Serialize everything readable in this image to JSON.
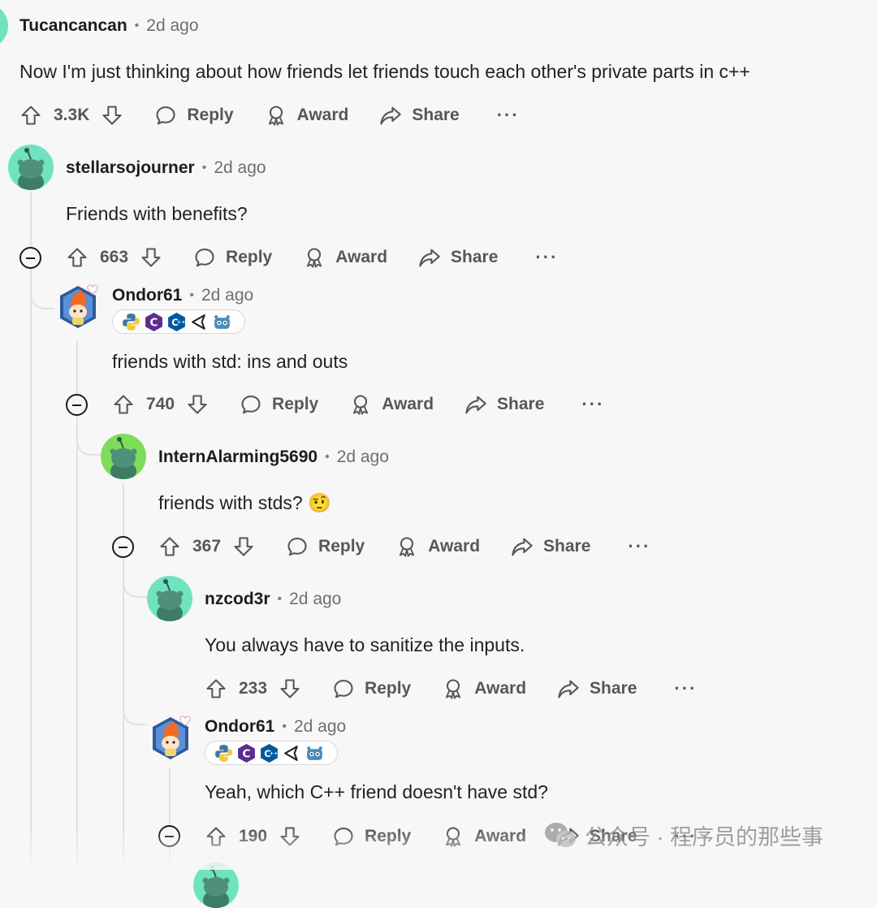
{
  "colors": {
    "background": "#f7f7f7",
    "text": "#1c1c1c",
    "muted": "#6f6f6f",
    "thread_line": "#e1e1e1",
    "avatar_mint": "#6fe3bf",
    "avatar_green": "#7fdb5a"
  },
  "common": {
    "reply_label": "Reply",
    "award_label": "Award",
    "share_label": "Share",
    "more_label": "···",
    "separator": "•"
  },
  "comments": [
    {
      "author": "Tucancancan",
      "time": "2d ago",
      "body": "Now I'm just thinking about how friends let friends touch each other's private parts in c++",
      "votes": "3.3K",
      "avatar_icon": "snoo-avatar-icon"
    },
    {
      "author": "stellarsojourner",
      "time": "2d ago",
      "body": "Friends with benefits?",
      "votes": "663",
      "avatar_icon": "snoo-avatar-icon"
    },
    {
      "author": "Ondor61",
      "time": "2d ago",
      "body": "friends with std: ins and outs",
      "votes": "740",
      "avatar_icon": "fire-snoo-avatar-icon",
      "flair": [
        "python-icon",
        "c-icon",
        "cpp-icon",
        "unity-icon",
        "godot-icon"
      ]
    },
    {
      "author": "InternAlarming5690",
      "time": "2d ago",
      "body": "friends with stds? 🤨",
      "votes": "367",
      "avatar_icon": "snoo-avatar-icon"
    },
    {
      "author": "nzcod3r",
      "time": "2d ago",
      "body": "You always have to sanitize the inputs.",
      "votes": "233",
      "avatar_icon": "snoo-avatar-icon"
    },
    {
      "author": "Ondor61",
      "time": "2d ago",
      "body": "Yeah, which C++ friend doesn't have std?",
      "votes": "190",
      "avatar_icon": "fire-snoo-avatar-icon",
      "flair": [
        "python-icon",
        "c-icon",
        "cpp-icon",
        "unity-icon",
        "godot-icon"
      ]
    }
  ],
  "watermark": {
    "text": "公众号 · 程序员的那些事",
    "icon": "wechat-icon"
  }
}
